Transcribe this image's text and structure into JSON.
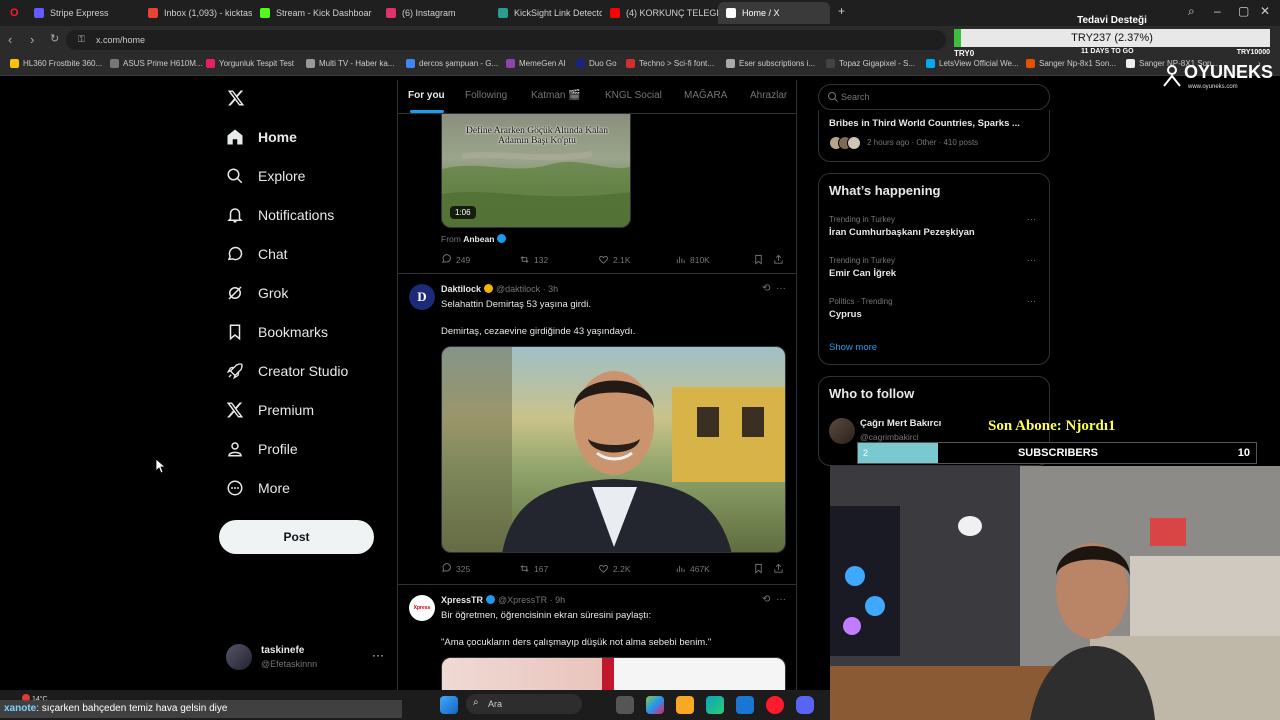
{
  "browser": {
    "tabs": [
      {
        "label": "Stripe Express",
        "color": "#635bff"
      },
      {
        "label": "Inbox (1,093) - kicktaskin...",
        "color": "#ea4335"
      },
      {
        "label": "Stream - Kick Dashboard",
        "color": "#53fc18"
      },
      {
        "label": "(6) Instagram",
        "color": "#e1306c"
      },
      {
        "label": "KickSight Link Detector",
        "color": "#2a9d8f"
      },
      {
        "label": "(4) KORKUNÇ TELEGRAM",
        "color": "#ff0000"
      },
      {
        "label": "Home / X",
        "color": "#ffffff"
      }
    ],
    "url": "x.com/home",
    "bookmarks": [
      {
        "label": "HL360 Frostbite 360...",
        "color": "#ffc107"
      },
      {
        "label": "ASUS Prime H610M...",
        "color": "#777777"
      },
      {
        "label": "Yorgunluk Tespit Test",
        "color": "#e91e63"
      },
      {
        "label": "Multi TV - Haber ka...",
        "color": "#999999"
      },
      {
        "label": "dercos şampuan - G...",
        "color": "#4285f4"
      },
      {
        "label": "MemeGen AI",
        "color": "#8e44ad"
      },
      {
        "label": "Duo Go",
        "color": "#1a237e"
      },
      {
        "label": "Techno > Sci-fi font...",
        "color": "#d32f2f"
      },
      {
        "label": "Eser subscriptions i...",
        "color": "#aaaaaa"
      },
      {
        "label": "Topaz Gigapixel - S...",
        "color": "#444444"
      },
      {
        "label": "LetsView Official We...",
        "color": "#03a9f4"
      },
      {
        "label": "Sanger Np-8x1 Son...",
        "color": "#e65100"
      },
      {
        "label": "Sanger NP-8X1 Son...",
        "color": "#eeeeee"
      }
    ]
  },
  "overlay": {
    "donation_title": "Tedavi Desteği",
    "donation_amount": "TRY237 (2.37%)",
    "donation_progress": 0.0237,
    "donation_min": "TRY0",
    "donation_days": "11 DAYS TO GO",
    "donation_goal": "TRY10000",
    "brand": "OYUNEKS",
    "brand_url": "www.oyuneks.com",
    "sub_alert": "Son Abone: Njordı1",
    "sub_current": "2",
    "sub_label": "SUBSCRIBERS",
    "sub_goal": "10",
    "sub_progress": 0.2,
    "chat_user": "xanote",
    "chat_message": ": sıçarken bahçeden temiz hava gelsin diye"
  },
  "nav": {
    "items": [
      {
        "label": "Home",
        "icon": "home-icon"
      },
      {
        "label": "Explore",
        "icon": "search-icon"
      },
      {
        "label": "Notifications",
        "icon": "bell-icon"
      },
      {
        "label": "Chat",
        "icon": "chat-icon"
      },
      {
        "label": "Grok",
        "icon": "grok-icon"
      },
      {
        "label": "Bookmarks",
        "icon": "bookmark-icon"
      },
      {
        "label": "Creator Studio",
        "icon": "rocket-icon"
      },
      {
        "label": "Premium",
        "icon": "x-logo-icon"
      },
      {
        "label": "Profile",
        "icon": "person-icon"
      },
      {
        "label": "More",
        "icon": "more-circle-icon"
      }
    ],
    "post_label": "Post",
    "account": {
      "name": "taskinefe",
      "handle": "@Efetaskinnn"
    }
  },
  "feed": {
    "tabs": [
      "For you",
      "Following",
      "Katman 🎬",
      "KNGL Social",
      "MAĞARA",
      "Ahrazlar"
    ],
    "tweet0": {
      "video_caption": "Define Ararken Göçük Altında Kalan Adamın Başı Ko'ptu",
      "duration": "1:06",
      "from_label": "From",
      "from_name": "Anbean",
      "replies": "249",
      "reposts": "132",
      "likes": "2.1K",
      "views": "810K"
    },
    "tweet1": {
      "name": "Daktilock",
      "handle": "@daktilock · 3h",
      "avatar_letter": "D",
      "line1": "Selahattin Demirtaş 53 yaşına girdi.",
      "line2": "Demirtaş, cezaevine girdiğinde 43 yaşındaydı.",
      "replies": "325",
      "reposts": "167",
      "likes": "2.2K",
      "views": "467K"
    },
    "tweet2": {
      "name": "XpressTR",
      "handle": "@XpressTR · 9h",
      "avatar_text": "Xpress",
      "line1": "Bir öğretmen, öğrencisinin ekran süresini paylaştı:",
      "line2": "\"Ama çocukların ders çalışmayıp düşük not alma sebebi benim.\""
    }
  },
  "right": {
    "search_placeholder": "Search",
    "news_title": "Bribes in Third World Countries, Sparks ...",
    "news_meta": "2 hours ago · Other · 410 posts",
    "happening_title": "What’s happening",
    "trends": [
      {
        "context": "Trending in Turkey",
        "name": "İran Cumhurbaşkanı Pezeşkiyan"
      },
      {
        "context": "Trending in Turkey",
        "name": "Emir Can İğrek"
      },
      {
        "context": "Politics · Trending",
        "name": "Cyprus"
      }
    ],
    "show_more": "Show more",
    "follow_title": "Who to follow",
    "follow": {
      "name": "Çağrı Mert Bakırcı",
      "handle": "@cagrimbakirci"
    }
  },
  "taskbar": {
    "weather": "14°C",
    "search_label": "Ara"
  },
  "colors": {
    "accent": "#1d9bf0",
    "background": "#000000",
    "border": "#2f3336",
    "muted": "#71767b"
  }
}
